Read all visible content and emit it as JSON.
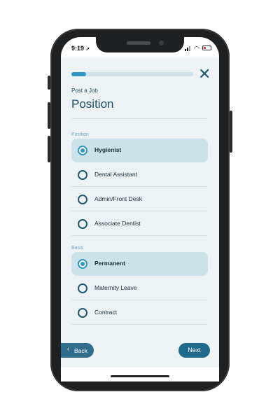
{
  "status_bar": {
    "time": "9:19",
    "location_icon": "location-arrow-icon",
    "signal_icon": "cellular-signal-icon",
    "wifi_icon": "wifi-icon",
    "battery_icon": "battery-low-icon",
    "battery_level": 0.2
  },
  "header": {
    "progress": 0.12,
    "close_icon": "close-icon",
    "step_label": "Post a Job",
    "title": "Position"
  },
  "position_section": {
    "label": "Position",
    "options": [
      {
        "label": "Hygienist",
        "selected": true
      },
      {
        "label": "Dental Assistant",
        "selected": false
      },
      {
        "label": "Admin/Front Desk",
        "selected": false
      },
      {
        "label": "Associate Dentist",
        "selected": false
      }
    ]
  },
  "basis_section": {
    "label": "Basis",
    "options": [
      {
        "label": "Permanent",
        "selected": true
      },
      {
        "label": "Maternity Leave",
        "selected": false
      },
      {
        "label": "Contract",
        "selected": false
      }
    ]
  },
  "footer": {
    "back_label": "Back",
    "back_icon": "chevron-left-icon",
    "next_label": "Next"
  },
  "colors": {
    "accent": "#2f97c6",
    "primary_dark": "#1a4f66",
    "selected_bg": "#cde1ea",
    "screen_bg": "#edf2f5"
  }
}
